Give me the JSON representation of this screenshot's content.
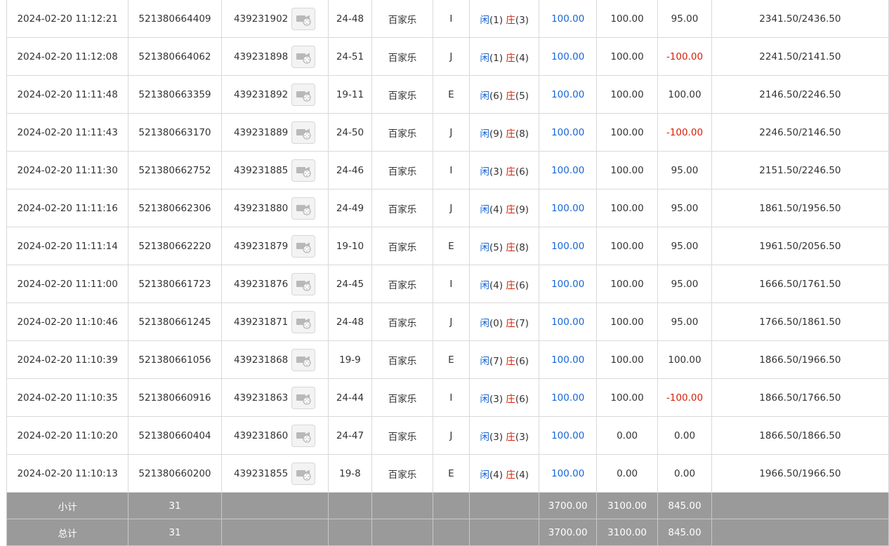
{
  "colors": {
    "player": "#1766d6",
    "banker": "#d81e06",
    "negative": "#d81e06",
    "bet": "#1766d6",
    "total_bg": "#9a9a9a"
  },
  "icons": {
    "video": "video-camera-icon"
  },
  "rows": [
    {
      "time": "2024-02-20 11:12:21",
      "bet_id": "521380664409",
      "round_id": "439231902",
      "shoe": "24-48",
      "game": "百家乐",
      "table": "I",
      "player_label": "闲",
      "player_pts": "(1)",
      "banker_label": "庄",
      "banker_pts": "(3)",
      "bet": "100.00",
      "valid": "100.00",
      "win": "95.00",
      "win_negative": false,
      "balance": "2341.50/2436.50"
    },
    {
      "time": "2024-02-20 11:12:08",
      "bet_id": "521380664062",
      "round_id": "439231898",
      "shoe": "24-51",
      "game": "百家乐",
      "table": "J",
      "player_label": "闲",
      "player_pts": "(1)",
      "banker_label": "庄",
      "banker_pts": "(4)",
      "bet": "100.00",
      "valid": "100.00",
      "win": "-100.00",
      "win_negative": true,
      "balance": "2241.50/2141.50"
    },
    {
      "time": "2024-02-20 11:11:48",
      "bet_id": "521380663359",
      "round_id": "439231892",
      "shoe": "19-11",
      "game": "百家乐",
      "table": "E",
      "player_label": "闲",
      "player_pts": "(6)",
      "banker_label": "庄",
      "banker_pts": "(5)",
      "bet": "100.00",
      "valid": "100.00",
      "win": "100.00",
      "win_negative": false,
      "balance": "2146.50/2246.50"
    },
    {
      "time": "2024-02-20 11:11:43",
      "bet_id": "521380663170",
      "round_id": "439231889",
      "shoe": "24-50",
      "game": "百家乐",
      "table": "J",
      "player_label": "闲",
      "player_pts": "(9)",
      "banker_label": "庄",
      "banker_pts": "(8)",
      "bet": "100.00",
      "valid": "100.00",
      "win": "-100.00",
      "win_negative": true,
      "balance": "2246.50/2146.50"
    },
    {
      "time": "2024-02-20 11:11:30",
      "bet_id": "521380662752",
      "round_id": "439231885",
      "shoe": "24-46",
      "game": "百家乐",
      "table": "I",
      "player_label": "闲",
      "player_pts": "(3)",
      "banker_label": "庄",
      "banker_pts": "(6)",
      "bet": "100.00",
      "valid": "100.00",
      "win": "95.00",
      "win_negative": false,
      "balance": "2151.50/2246.50"
    },
    {
      "time": "2024-02-20 11:11:16",
      "bet_id": "521380662306",
      "round_id": "439231880",
      "shoe": "24-49",
      "game": "百家乐",
      "table": "J",
      "player_label": "闲",
      "player_pts": "(4)",
      "banker_label": "庄",
      "banker_pts": "(9)",
      "bet": "100.00",
      "valid": "100.00",
      "win": "95.00",
      "win_negative": false,
      "balance": "1861.50/1956.50"
    },
    {
      "time": "2024-02-20 11:11:14",
      "bet_id": "521380662220",
      "round_id": "439231879",
      "shoe": "19-10",
      "game": "百家乐",
      "table": "E",
      "player_label": "闲",
      "player_pts": "(5)",
      "banker_label": "庄",
      "banker_pts": "(8)",
      "bet": "100.00",
      "valid": "100.00",
      "win": "95.00",
      "win_negative": false,
      "balance": "1961.50/2056.50"
    },
    {
      "time": "2024-02-20 11:11:00",
      "bet_id": "521380661723",
      "round_id": "439231876",
      "shoe": "24-45",
      "game": "百家乐",
      "table": "I",
      "player_label": "闲",
      "player_pts": "(4)",
      "banker_label": "庄",
      "banker_pts": "(6)",
      "bet": "100.00",
      "valid": "100.00",
      "win": "95.00",
      "win_negative": false,
      "balance": "1666.50/1761.50"
    },
    {
      "time": "2024-02-20 11:10:46",
      "bet_id": "521380661245",
      "round_id": "439231871",
      "shoe": "24-48",
      "game": "百家乐",
      "table": "J",
      "player_label": "闲",
      "player_pts": "(0)",
      "banker_label": "庄",
      "banker_pts": "(7)",
      "bet": "100.00",
      "valid": "100.00",
      "win": "95.00",
      "win_negative": false,
      "balance": "1766.50/1861.50"
    },
    {
      "time": "2024-02-20 11:10:39",
      "bet_id": "521380661056",
      "round_id": "439231868",
      "shoe": "19-9",
      "game": "百家乐",
      "table": "E",
      "player_label": "闲",
      "player_pts": "(7)",
      "banker_label": "庄",
      "banker_pts": "(6)",
      "bet": "100.00",
      "valid": "100.00",
      "win": "100.00",
      "win_negative": false,
      "balance": "1866.50/1966.50"
    },
    {
      "time": "2024-02-20 11:10:35",
      "bet_id": "521380660916",
      "round_id": "439231863",
      "shoe": "24-44",
      "game": "百家乐",
      "table": "I",
      "player_label": "闲",
      "player_pts": "(3)",
      "banker_label": "庄",
      "banker_pts": "(6)",
      "bet": "100.00",
      "valid": "100.00",
      "win": "-100.00",
      "win_negative": true,
      "balance": "1866.50/1766.50"
    },
    {
      "time": "2024-02-20 11:10:20",
      "bet_id": "521380660404",
      "round_id": "439231860",
      "shoe": "24-47",
      "game": "百家乐",
      "table": "J",
      "player_label": "闲",
      "player_pts": "(3)",
      "banker_label": "庄",
      "banker_pts": "(3)",
      "bet": "100.00",
      "valid": "0.00",
      "win": "0.00",
      "win_negative": false,
      "balance": "1866.50/1866.50"
    },
    {
      "time": "2024-02-20 11:10:13",
      "bet_id": "521380660200",
      "round_id": "439231855",
      "shoe": "19-8",
      "game": "百家乐",
      "table": "E",
      "player_label": "闲",
      "player_pts": "(4)",
      "banker_label": "庄",
      "banker_pts": "(4)",
      "bet": "100.00",
      "valid": "0.00",
      "win": "0.00",
      "win_negative": false,
      "balance": "1966.50/1966.50"
    }
  ],
  "totals": [
    {
      "label": "小计",
      "count": "31",
      "bet": "3700.00",
      "valid": "3100.00",
      "win": "845.00"
    },
    {
      "label": "总计",
      "count": "31",
      "bet": "3700.00",
      "valid": "3100.00",
      "win": "845.00"
    }
  ]
}
